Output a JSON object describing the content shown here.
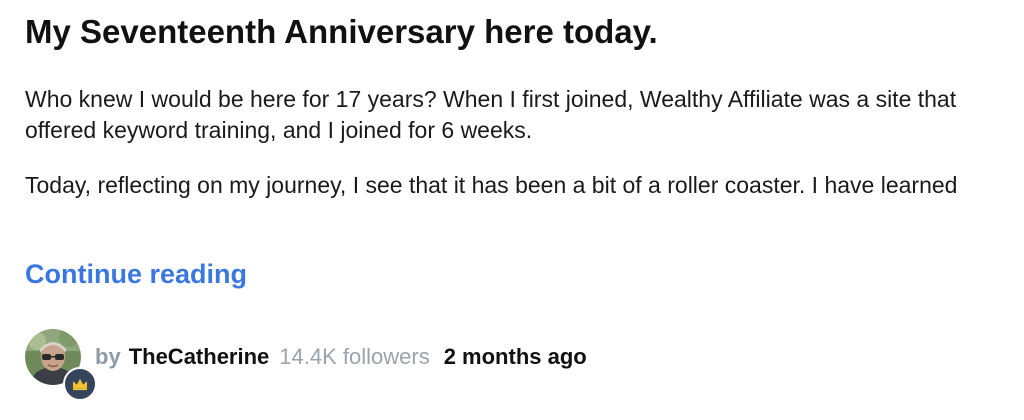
{
  "post": {
    "title": "My Seventeenth Anniversary here today.",
    "paragraphs": [
      "Who knew I would be here for 17 years? When I first joined, Wealthy Affiliate was a site that offered keyword training, and I joined for 6 weeks.",
      "Today, reflecting on my journey, I see that it has been a bit of a roller coaster. I have learned"
    ],
    "continue_label": "Continue reading"
  },
  "meta": {
    "by_label": "by",
    "author": "TheCatherine",
    "followers": "14.4K followers",
    "posted_ago": "2 months ago",
    "avatar_icon": "user-avatar-photo",
    "badge_icon": "crown-icon"
  },
  "colors": {
    "link": "#3a78e0",
    "muted": "#9aa4ae",
    "badge": "#33445c",
    "crown": "#f2c230"
  }
}
